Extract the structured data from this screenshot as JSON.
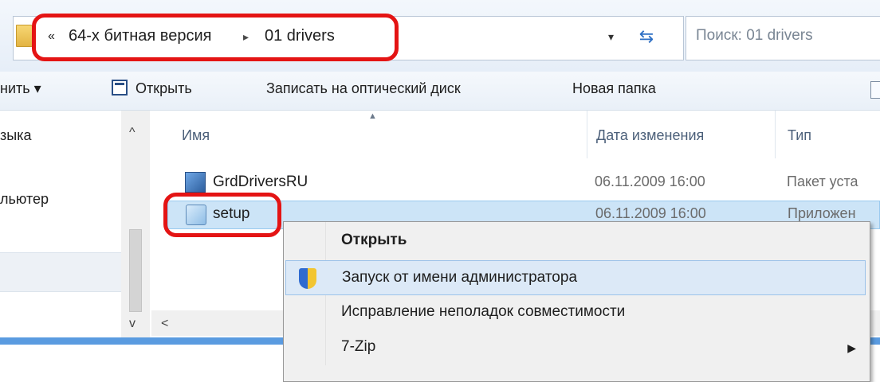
{
  "address_bar": {
    "breadcrumb_prefix": "«",
    "crumb_1": "64-х битная версия",
    "crumb_2": "01 drivers",
    "separator": "▸",
    "dropdown_glyph": "▾",
    "refresh_glyph": "⇆",
    "search_placeholder": "Поиск: 01 drivers"
  },
  "toolbar": {
    "organize_label": "нить ▾",
    "open_label": "Открыть",
    "burn_label": "Записать на оптический диск",
    "new_folder_label": "Новая папка"
  },
  "nav_pane": {
    "items": [
      "зыка",
      "льютер"
    ]
  },
  "file_list": {
    "columns": {
      "name": "Имя",
      "date": "Дата изменения",
      "type": "Тип"
    },
    "rows": [
      {
        "name": "GrdDriversRU",
        "date": "06.11.2009 16:00",
        "type": "Пакет уста"
      },
      {
        "name": "setup",
        "date": "06.11.2009 16:00",
        "type": "Приложен"
      }
    ]
  },
  "context_menu": {
    "items": [
      {
        "label": "Открыть",
        "bold": true
      },
      {
        "label": "Запуск от имени администратора",
        "icon": "uac-shield-icon"
      },
      {
        "label": "Исправление неполадок совместимости"
      },
      {
        "label": "7-Zip",
        "has_submenu": true
      }
    ]
  },
  "colors": {
    "highlight": "#e41414",
    "selection": "#cce4f7",
    "menu_hover": "#dce9f7",
    "accent_band": "#5a9be0"
  }
}
